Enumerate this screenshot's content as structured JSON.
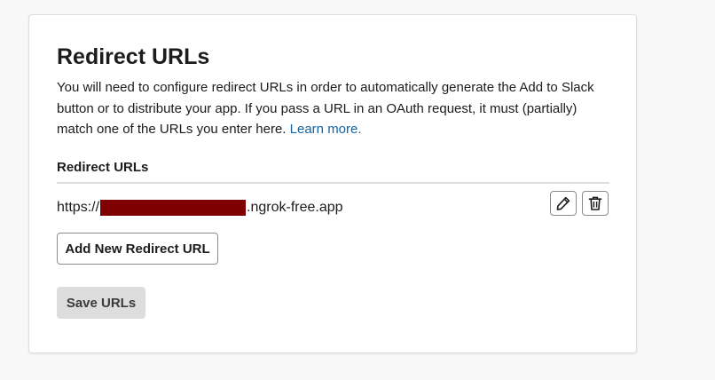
{
  "section": {
    "title": "Redirect URLs",
    "description": "You will need to configure redirect URLs in order to automatically generate the Add to Slack button or to distribute your app. If you pass a URL in an OAuth request, it must (partially) match one of the URLs you enter here.",
    "learn_more": "Learn more.",
    "list_label": "Redirect URLs"
  },
  "urls": [
    {
      "prefix": "https://",
      "suffix": ".ngrok-free.app",
      "redacted_color": "#7f0000"
    }
  ],
  "icons": {
    "edit": "pencil-icon",
    "delete": "trash-icon"
  },
  "buttons": {
    "add": "Add New Redirect URL",
    "save": "Save URLs"
  },
  "colors": {
    "link": "#1264a3",
    "text": "#1d1c1d",
    "disabled_button_bg": "#dddddd"
  }
}
